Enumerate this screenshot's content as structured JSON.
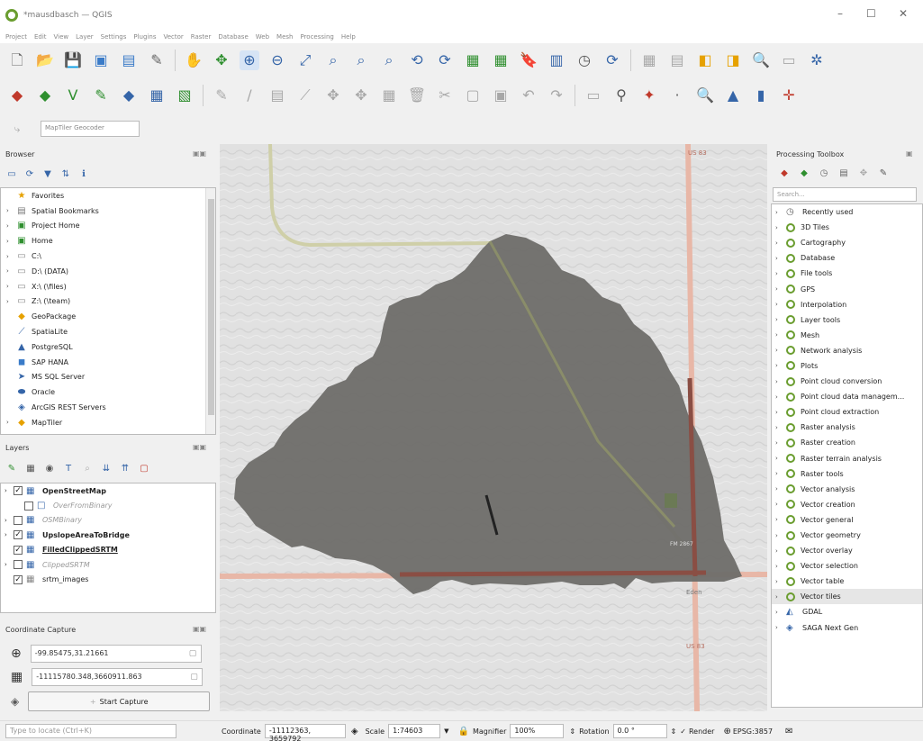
{
  "window": {
    "title": "*mausdbasch — QGIS",
    "controls": [
      "–",
      "☐",
      "✕"
    ]
  },
  "menus": [
    "Project",
    "Edit",
    "View",
    "Layer",
    "Settings",
    "Plugins",
    "Vector",
    "Raster",
    "Database",
    "Web",
    "Mesh",
    "Processing",
    "Help"
  ],
  "locator_toolbar_placeholder": "MapTiler Geocoder",
  "browser": {
    "title": "Browser",
    "items": [
      {
        "label": "Favorites",
        "icon": "star-icon",
        "expand": false
      },
      {
        "label": "Spatial Bookmarks",
        "icon": "bookmark-icon",
        "expand": true
      },
      {
        "label": "Project Home",
        "icon": "folder-icon",
        "expand": true
      },
      {
        "label": "Home",
        "icon": "folder-icon",
        "expand": true
      },
      {
        "label": "C:\\",
        "icon": "drive-icon",
        "expand": true
      },
      {
        "label": "D:\\ (DATA)",
        "icon": "drive-icon",
        "expand": true
      },
      {
        "label": "X:\\ (\\files)",
        "icon": "drive-icon",
        "expand": true
      },
      {
        "label": "Z:\\ (\\team)",
        "icon": "drive-icon",
        "expand": true
      },
      {
        "label": "GeoPackage",
        "icon": "geopackage-icon",
        "expand": false
      },
      {
        "label": "SpatiaLite",
        "icon": "spatialite-icon",
        "expand": false
      },
      {
        "label": "PostgreSQL",
        "icon": "postgresql-icon",
        "expand": false
      },
      {
        "label": "SAP HANA",
        "icon": "sap-hana-icon",
        "expand": false
      },
      {
        "label": "MS SQL Server",
        "icon": "mssql-icon",
        "expand": false
      },
      {
        "label": "Oracle",
        "icon": "oracle-icon",
        "expand": false
      },
      {
        "label": "ArcGIS REST Servers",
        "icon": "arcgis-icon",
        "expand": false
      },
      {
        "label": "MapTiler",
        "icon": "maptiler-icon",
        "expand": true
      }
    ]
  },
  "layers": {
    "title": "Layers",
    "items": [
      {
        "label": "OpenStreetMap",
        "checked": true,
        "bold": true,
        "italic": false,
        "expand": true,
        "indent": 0
      },
      {
        "label": "OverFromBinary",
        "checked": false,
        "bold": false,
        "italic": true,
        "expand": false,
        "indent": 1
      },
      {
        "label": "OSMBinary",
        "checked": false,
        "bold": false,
        "italic": true,
        "expand": true,
        "indent": 0
      },
      {
        "label": "UpslopeAreaToBridge",
        "checked": true,
        "bold": true,
        "italic": false,
        "expand": true,
        "indent": 0
      },
      {
        "label": "FilledClippedSRTM",
        "checked": true,
        "bold": true,
        "italic": false,
        "expand": false,
        "indent": 0
      },
      {
        "label": "ClippedSRTM",
        "checked": false,
        "bold": false,
        "italic": true,
        "expand": true,
        "indent": 0
      },
      {
        "label": "srtm_images",
        "checked": true,
        "bold": false,
        "italic": false,
        "expand": false,
        "indent": 0
      }
    ]
  },
  "coordinate_capture": {
    "title": "Coordinate Capture",
    "wgs84": "-99.85475,31.21661",
    "projected": "-11115780.348,3660911.863",
    "start_label": "Start Capture"
  },
  "processing": {
    "title": "Processing Toolbox",
    "search_placeholder": "Search...",
    "items": [
      {
        "label": "Recently used",
        "icon": "clock-icon"
      },
      {
        "label": "3D Tiles",
        "icon": "qgis-icon"
      },
      {
        "label": "Cartography",
        "icon": "qgis-icon"
      },
      {
        "label": "Database",
        "icon": "qgis-icon"
      },
      {
        "label": "File tools",
        "icon": "qgis-icon"
      },
      {
        "label": "GPS",
        "icon": "qgis-icon"
      },
      {
        "label": "Interpolation",
        "icon": "qgis-icon"
      },
      {
        "label": "Layer tools",
        "icon": "qgis-icon"
      },
      {
        "label": "Mesh",
        "icon": "qgis-icon"
      },
      {
        "label": "Network analysis",
        "icon": "qgis-icon"
      },
      {
        "label": "Plots",
        "icon": "qgis-icon"
      },
      {
        "label": "Point cloud conversion",
        "icon": "qgis-icon"
      },
      {
        "label": "Point cloud data managem...",
        "icon": "qgis-icon"
      },
      {
        "label": "Point cloud extraction",
        "icon": "qgis-icon"
      },
      {
        "label": "Raster analysis",
        "icon": "qgis-icon"
      },
      {
        "label": "Raster creation",
        "icon": "qgis-icon"
      },
      {
        "label": "Raster terrain analysis",
        "icon": "qgis-icon"
      },
      {
        "label": "Raster tools",
        "icon": "qgis-icon"
      },
      {
        "label": "Vector analysis",
        "icon": "qgis-icon"
      },
      {
        "label": "Vector creation",
        "icon": "qgis-icon"
      },
      {
        "label": "Vector general",
        "icon": "qgis-icon"
      },
      {
        "label": "Vector geometry",
        "icon": "qgis-icon"
      },
      {
        "label": "Vector overlay",
        "icon": "qgis-icon"
      },
      {
        "label": "Vector selection",
        "icon": "qgis-icon"
      },
      {
        "label": "Vector table",
        "icon": "qgis-icon"
      },
      {
        "label": "Vector tiles",
        "icon": "qgis-icon",
        "selected": true
      },
      {
        "label": "GDAL",
        "icon": "gdal-icon"
      },
      {
        "label": "SAGA Next Gen",
        "icon": "saga-icon"
      }
    ]
  },
  "map": {
    "road_labels": [
      "US 83",
      "Eden",
      "FM 2867",
      "US 83"
    ],
    "watershed_color": "#6e6d69"
  },
  "statusbar": {
    "locator_placeholder": "Type to locate (Ctrl+K)",
    "coordinate_label": "Coordinate",
    "coordinate_value": "-11112363, 3659792",
    "scale_label": "Scale",
    "scale_value": "1:74603",
    "magnifier_label": "Magnifier",
    "magnifier_value": "100%",
    "rotation_label": "Rotation",
    "rotation_value": "0.0 °",
    "render_label": "Render",
    "crs_label": "EPSG:3857"
  },
  "colors": {
    "qgis_green": "#6a9d2f",
    "road": "#e8b7a7",
    "map_bg": "#e3e3e3"
  }
}
